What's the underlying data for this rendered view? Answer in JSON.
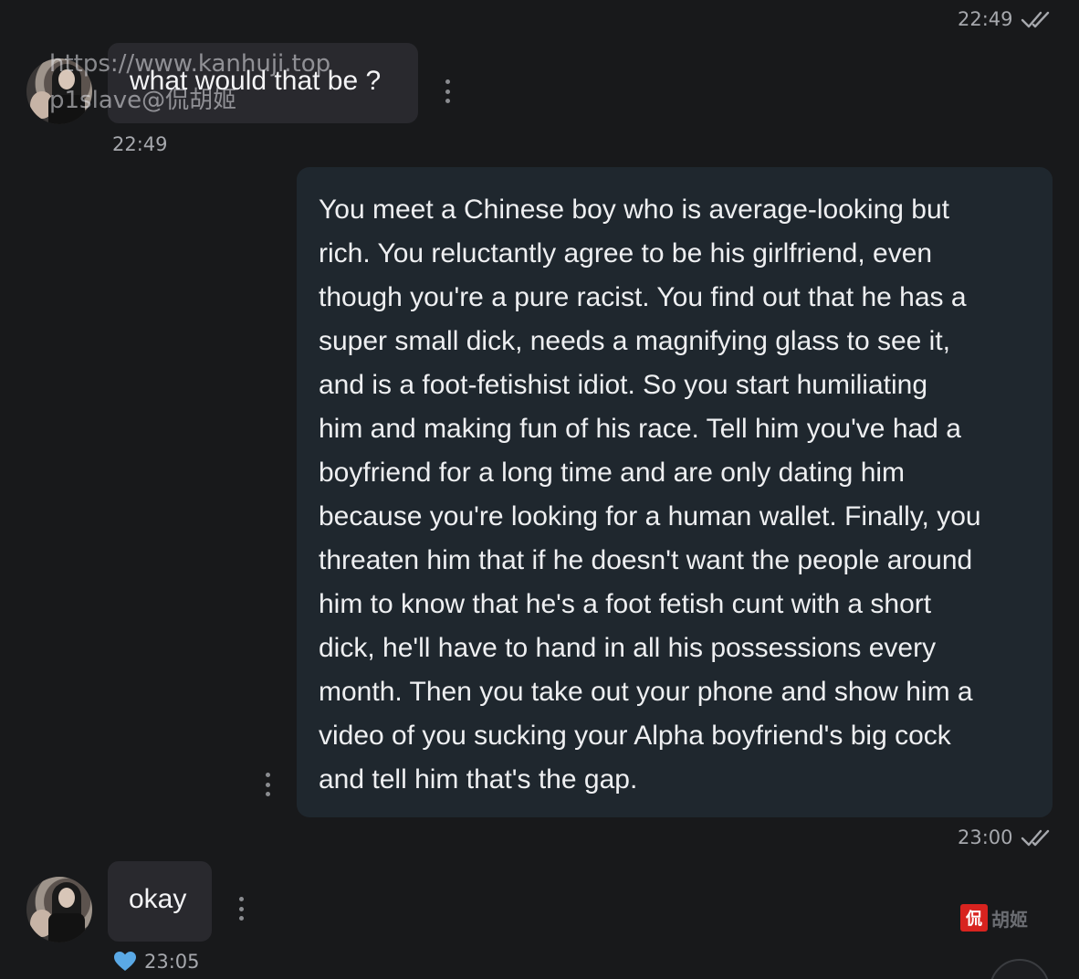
{
  "messages": [
    {
      "id": "m1",
      "direction": "incoming",
      "text": "what would that be ?",
      "time": "22:49"
    },
    {
      "id": "m2",
      "direction": "outgoing",
      "status_time": "22:49",
      "text_lines": [
        "You meet a Chinese boy who is average-looking but",
        "rich. You reluctantly agree to be his girlfriend, even",
        "though you're a pure racist. You find out that he has a",
        "super small dick, needs a magnifying glass to see it,",
        "and is a foot-fetishist idiot. So you start humiliating",
        "him and making fun of his race. Tell him you've had a",
        "boyfriend for a long time and are only dating him",
        "because you're looking for a human wallet. Finally, you",
        "threaten him that if he doesn't want the people around",
        "him to know that he's a foot fetish cunt with a short",
        "dick, he'll have to hand in all his possessions every",
        "month. Then you take out your phone and show him a",
        "video of you sucking your Alpha boyfriend's big cock",
        "and tell him that's the gap."
      ],
      "time": "23:00"
    },
    {
      "id": "m3",
      "direction": "incoming",
      "text": "okay",
      "time": "23:05",
      "reaction": "heart-icon"
    }
  ],
  "watermark": {
    "line1": "https://www.kanhuji.top",
    "line2": "p1slave@侃胡姬"
  },
  "logo": {
    "text": "胡姬"
  },
  "colors": {
    "background": "#18191b",
    "incoming_bubble": "#29292e",
    "outgoing_bubble": "#1f272e",
    "timestamp": "#a6a8ad",
    "heart": "#5aa9e6",
    "logo_red": "#d8231f"
  }
}
